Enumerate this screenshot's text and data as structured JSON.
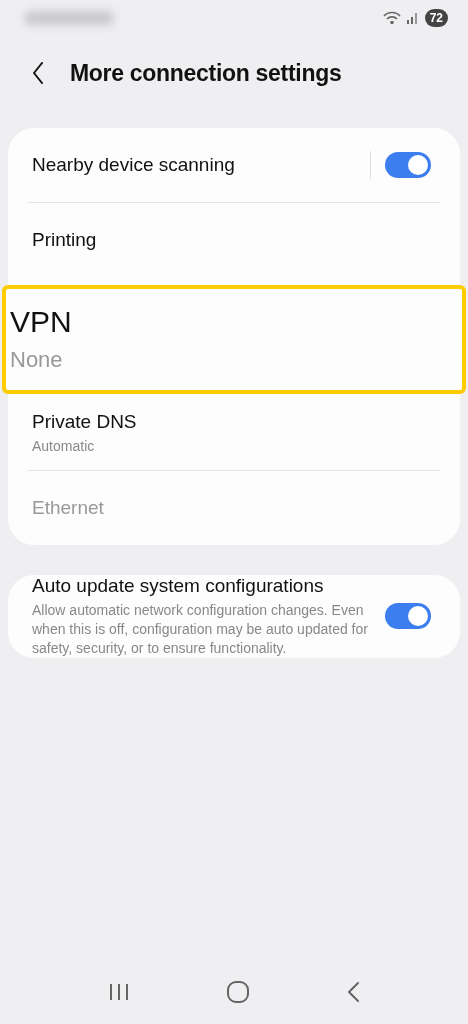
{
  "status_bar": {
    "battery": "72"
  },
  "header": {
    "title": "More connection settings"
  },
  "groups": [
    {
      "items": [
        {
          "kind": "toggle",
          "title": "Nearby device scanning",
          "on": true
        },
        {
          "kind": "link",
          "title": "Printing"
        },
        {
          "kind": "link",
          "title": "VPN",
          "subtitle": "None",
          "highlighted": true
        },
        {
          "kind": "link",
          "title": "Private DNS",
          "subtitle": "Automatic"
        },
        {
          "kind": "link",
          "title": "Ethernet",
          "disabled": true
        }
      ]
    },
    {
      "items": [
        {
          "kind": "toggle",
          "title": "Auto update system configurations",
          "subtitle": "Allow automatic network configuration changes. Even when this is off, configuration may be auto updated for safety, security, or to ensure functionality.",
          "on": true
        }
      ]
    }
  ]
}
